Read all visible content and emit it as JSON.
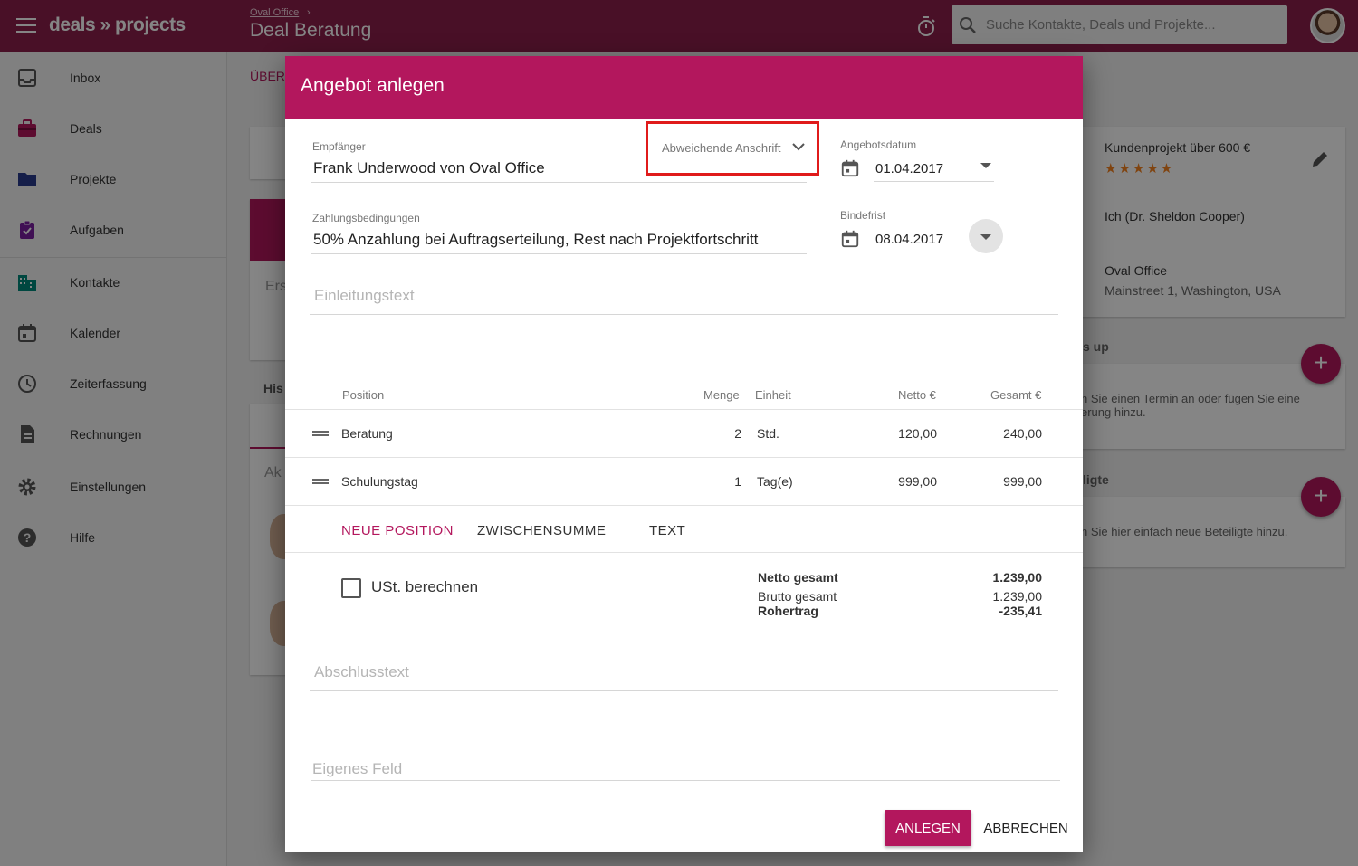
{
  "topbar": {
    "logo": "deals » projects",
    "breadcrumb_parent": "Oval Office",
    "breadcrumb_sep": "›",
    "page_title": "Deal Beratung",
    "search_placeholder": "Suche Kontakte, Deals und Projekte..."
  },
  "sidebar": {
    "items": [
      {
        "label": "Inbox",
        "icon": "inbox-icon"
      },
      {
        "label": "Deals",
        "icon": "briefcase-icon"
      },
      {
        "label": "Projekte",
        "icon": "folder-icon"
      },
      {
        "label": "Aufgaben",
        "icon": "clipboard-check-icon"
      },
      {
        "label": "Kontakte",
        "icon": "building-icon"
      },
      {
        "label": "Kalender",
        "icon": "calendar-icon"
      },
      {
        "label": "Zeiterfassung",
        "icon": "clock-icon"
      },
      {
        "label": "Rechnungen",
        "icon": "document-icon"
      },
      {
        "label": "Einstellungen",
        "icon": "gear-icon"
      },
      {
        "label": "Hilfe",
        "icon": "help-icon"
      }
    ]
  },
  "background": {
    "tab_label": "ÜBER",
    "hist_label": "His",
    "ak_label": "Ak",
    "ers_label": "Ers",
    "project_title": "Kundenprojekt über 600 €",
    "stars": "★★★★★",
    "owner": "Ich (Dr. Sheldon Cooper)",
    "company": "Oval Office",
    "address": "Mainstreet 1, Washington, USA",
    "followup_heading": "s up",
    "followup_text": "n Sie einen Termin an oder fügen Sie eine erung hinzu.",
    "participants_heading": "ligte",
    "participants_text": "n Sie hier einfach neue Beteiligte hinzu."
  },
  "dialog": {
    "title": "Angebot anlegen",
    "recipient_label": "Empfänger",
    "recipient_value": "Frank Underwood von Oval Office",
    "alt_address_label": "Abweichende Anschrift",
    "offer_date_label": "Angebotsdatum",
    "offer_date_value": "01.04.2017",
    "payment_label": "Zahlungsbedingungen",
    "payment_value": "50% Anzahlung bei Auftragserteilung, Rest nach Projektfortschritt",
    "deadline_label": "Bindefrist",
    "deadline_value": "08.04.2017",
    "intro_placeholder": "Einleitungstext",
    "table": {
      "headers": {
        "position": "Position",
        "quantity": "Menge",
        "unit": "Einheit",
        "net": "Netto €",
        "total": "Gesamt €"
      },
      "rows": [
        {
          "position": "Beratung",
          "quantity": "2",
          "unit": "Std.",
          "net": "120,00",
          "total": "240,00"
        },
        {
          "position": "Schulungstag",
          "quantity": "1",
          "unit": "Tag(e)",
          "net": "999,00",
          "total": "999,00"
        }
      ]
    },
    "actions": {
      "new_position": "NEUE POSITION",
      "subtotal": "ZWISCHENSUMME",
      "text": "TEXT"
    },
    "vat_label": "USt. berechnen",
    "totals": {
      "net_label": "Netto gesamt",
      "net_value": "1.239,00",
      "gross_label": "Brutto gesamt",
      "gross_value": "1.239,00",
      "margin_label": "Rohertrag",
      "margin_value": "-235,41"
    },
    "closing_placeholder": "Abschlusstext",
    "custom_field_placeholder": "Eigenes Feld",
    "create_button": "ANLEGEN",
    "cancel_button": "ABBRECHEN"
  },
  "colors": {
    "brand": "#8c1f4c",
    "accent": "#b3175d",
    "highlight_box": "#e01b1b",
    "star": "#f58220"
  }
}
